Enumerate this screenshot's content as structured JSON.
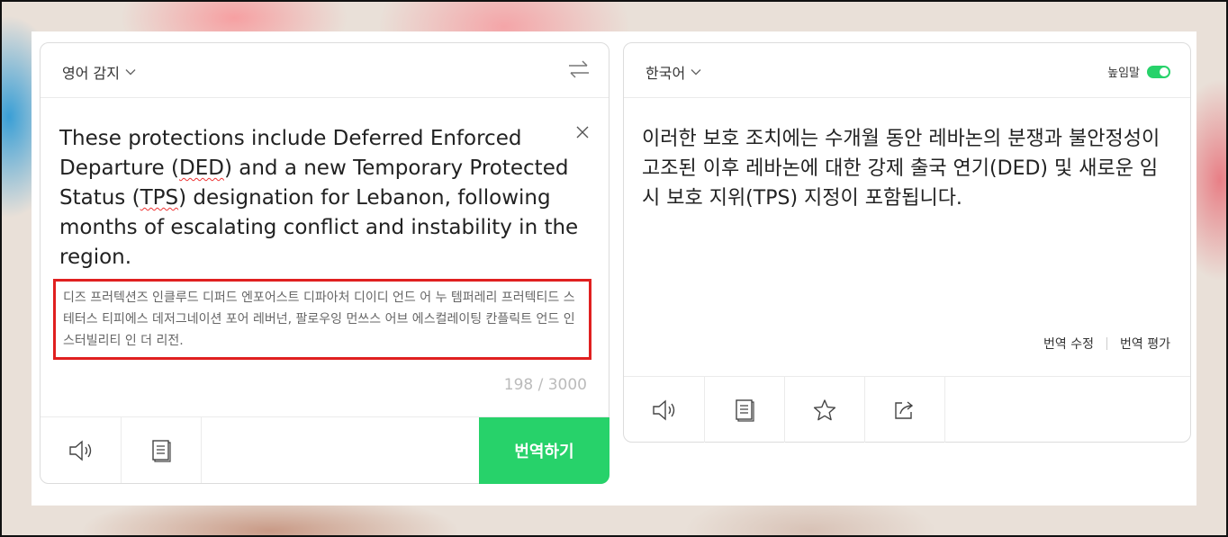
{
  "source": {
    "language_label": "영어 감지",
    "text_parts": [
      "These protections include Deferred Enforced Departure (",
      "DED",
      ") and a new Temporary Protected Status (",
      "TPS",
      ") designation for Lebanon, following months of escalating conflict and instability in the region."
    ],
    "pronunciation": "디즈 프러텍션즈 인클루드 디퍼드 엔포어스트 디파아처 디이디 언드 어 누 템퍼레리 프러텍티드 스테터스 티피에스 데저그네이션 포어 레버넌, 팔로우잉 먼쓰스 어브 에스컬레이팅 칸플릭트 언드 인스터빌리티 인 더 리전.",
    "char_count": "198 / 3000",
    "translate_button": "번역하기"
  },
  "target": {
    "language_label": "한국어",
    "honorific_label": "높임말",
    "honorific_on": true,
    "text": "이러한 보호 조치에는 수개월 동안 레바논의 분쟁과 불안정성이 고조된 이후 레바논에 대한 강제 출국 연기(DED) 및 새로운 임시 보호 지위(TPS) 지정이 포함됩니다.",
    "edit_label": "번역 수정",
    "rate_label": "번역 평가"
  },
  "colors": {
    "accent_green": "#27d26a",
    "highlight_red": "#e02020"
  }
}
